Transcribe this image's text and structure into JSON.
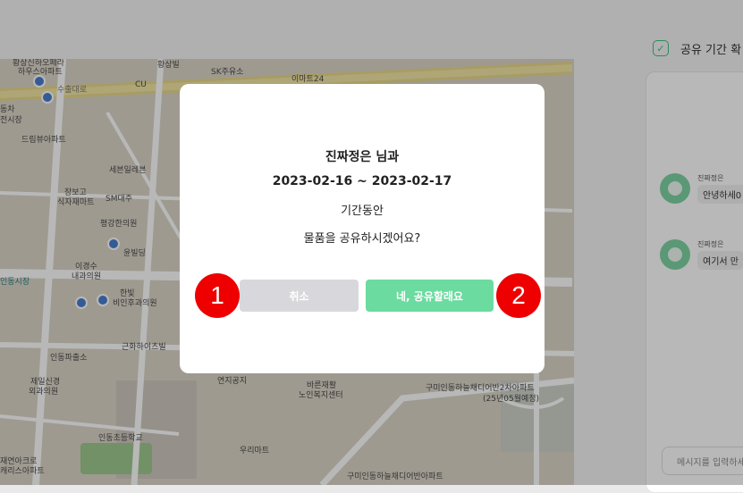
{
  "modal": {
    "line1": "진짜정은 님과",
    "line2": "2023-02-16 ~ 2023-02-17",
    "line3": "기간동안",
    "line4": "물품을 공유하시겠어요?",
    "cancel_label": "취소",
    "confirm_label": "네, 공유할래요"
  },
  "markers": {
    "first": "1",
    "second": "2"
  },
  "right_panel": {
    "title": "공유 기간 확",
    "messages": [
      {
        "name": "진짜정은",
        "text": "안녕하세0"
      },
      {
        "name": "진짜정은",
        "text": "여기서 만"
      }
    ],
    "input_placeholder": "메시지를 입력하세요"
  },
  "map": {
    "labels": [
      "황상신하오페라",
      "하우스아파트",
      "황상빌",
      "SK주유소",
      "이마트24",
      "CU",
      "동차",
      "전시장",
      "드림뷰아파트",
      "세븐일레븐",
      "장보고",
      "식자재마트",
      "SM대주",
      "평강한의원",
      "윤빌딩",
      "이경수",
      "내과의원",
      "한빛",
      "비인후과의원",
      "인동시장",
      "인동파출소",
      "근화하이츠빌",
      "제일신경",
      "외과의원",
      "연지공지",
      "바른재활",
      "노인복지센터",
      "구미인동하늘채디어반2차아파트",
      "(25년05월예정)",
      "인동초등학교",
      "우리마트",
      "재연아크로",
      "캐리스아파트",
      "구미인동하늘채디어반아파트",
      "수출대로"
    ]
  },
  "colors": {
    "confirm": "#6bdb9f",
    "cancel": "#d8d8dc",
    "marker": "#ee0000",
    "accent_green": "#3fbf7f"
  }
}
